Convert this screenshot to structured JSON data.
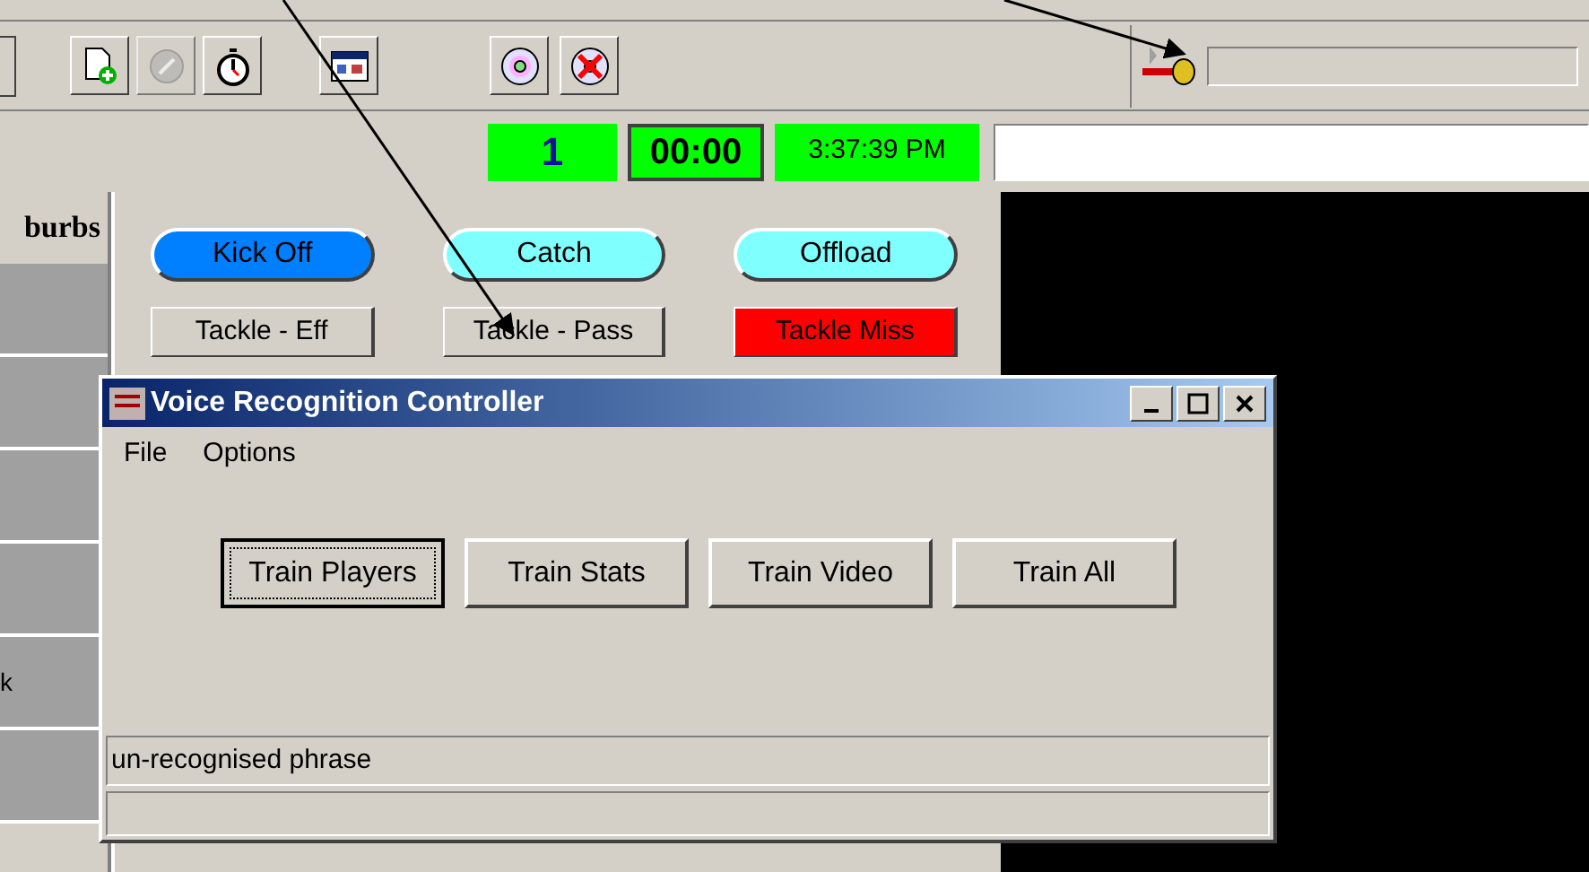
{
  "status_fields": [
    {
      "kind": "period",
      "text": "1"
    },
    {
      "kind": "timer",
      "text": "00:00"
    },
    {
      "kind": "clock",
      "text": "3:37:39 PM"
    }
  ],
  "team_column": {
    "header": "burbs",
    "row_label": "k"
  },
  "event_buttons": [
    {
      "label": "Kick Off",
      "kind": "oval",
      "color": "#0080ff"
    },
    {
      "label": "Catch",
      "kind": "oval",
      "color": "#80ffff"
    },
    {
      "label": "Offload",
      "kind": "oval",
      "color": "#80ffff"
    },
    {
      "label": "Tackle - Eff",
      "kind": "rect",
      "color": "#d4d0c8"
    },
    {
      "label": "Tackle - Pass",
      "kind": "rect",
      "color": "#d4d0c8"
    },
    {
      "label": "Tackle Miss",
      "kind": "rect",
      "color": "#ff0000"
    }
  ],
  "dialog": {
    "title": "Voice Recognition Controller",
    "menu": [
      "File",
      "Options"
    ],
    "buttons": [
      {
        "label": "Train Players",
        "focused": true
      },
      {
        "label": "Train Stats",
        "focused": false
      },
      {
        "label": "Train Video",
        "focused": false
      },
      {
        "label": "Train All",
        "focused": false
      }
    ],
    "status_text": "un-recognised phrase"
  }
}
